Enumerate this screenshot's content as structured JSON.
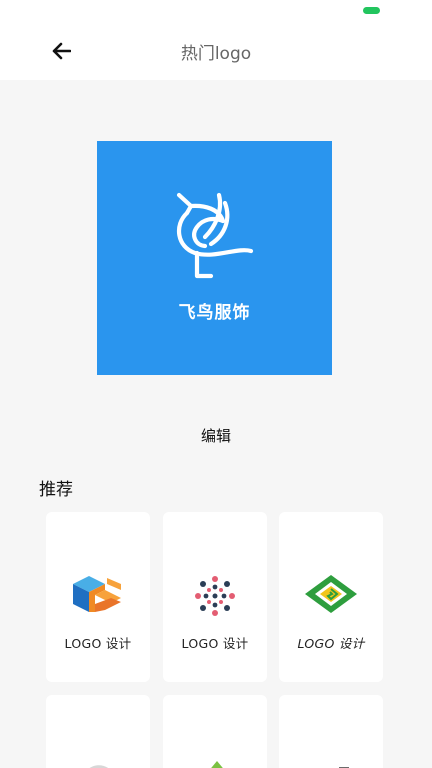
{
  "header": {
    "title": "热门logo"
  },
  "preview": {
    "brand_name": "飞鸟服饰",
    "color": "#2a95ee"
  },
  "actions": {
    "edit_label": "编辑"
  },
  "recommend": {
    "title": "推荐",
    "cards": [
      {
        "caption": "LOGO 设计",
        "icon": "cube-c-logo-icon"
      },
      {
        "caption": "LOGO 设计",
        "icon": "mandala-logo-icon"
      },
      {
        "caption": "LOGO 设计",
        "icon": "green-diamond-logo-icon"
      }
    ]
  }
}
